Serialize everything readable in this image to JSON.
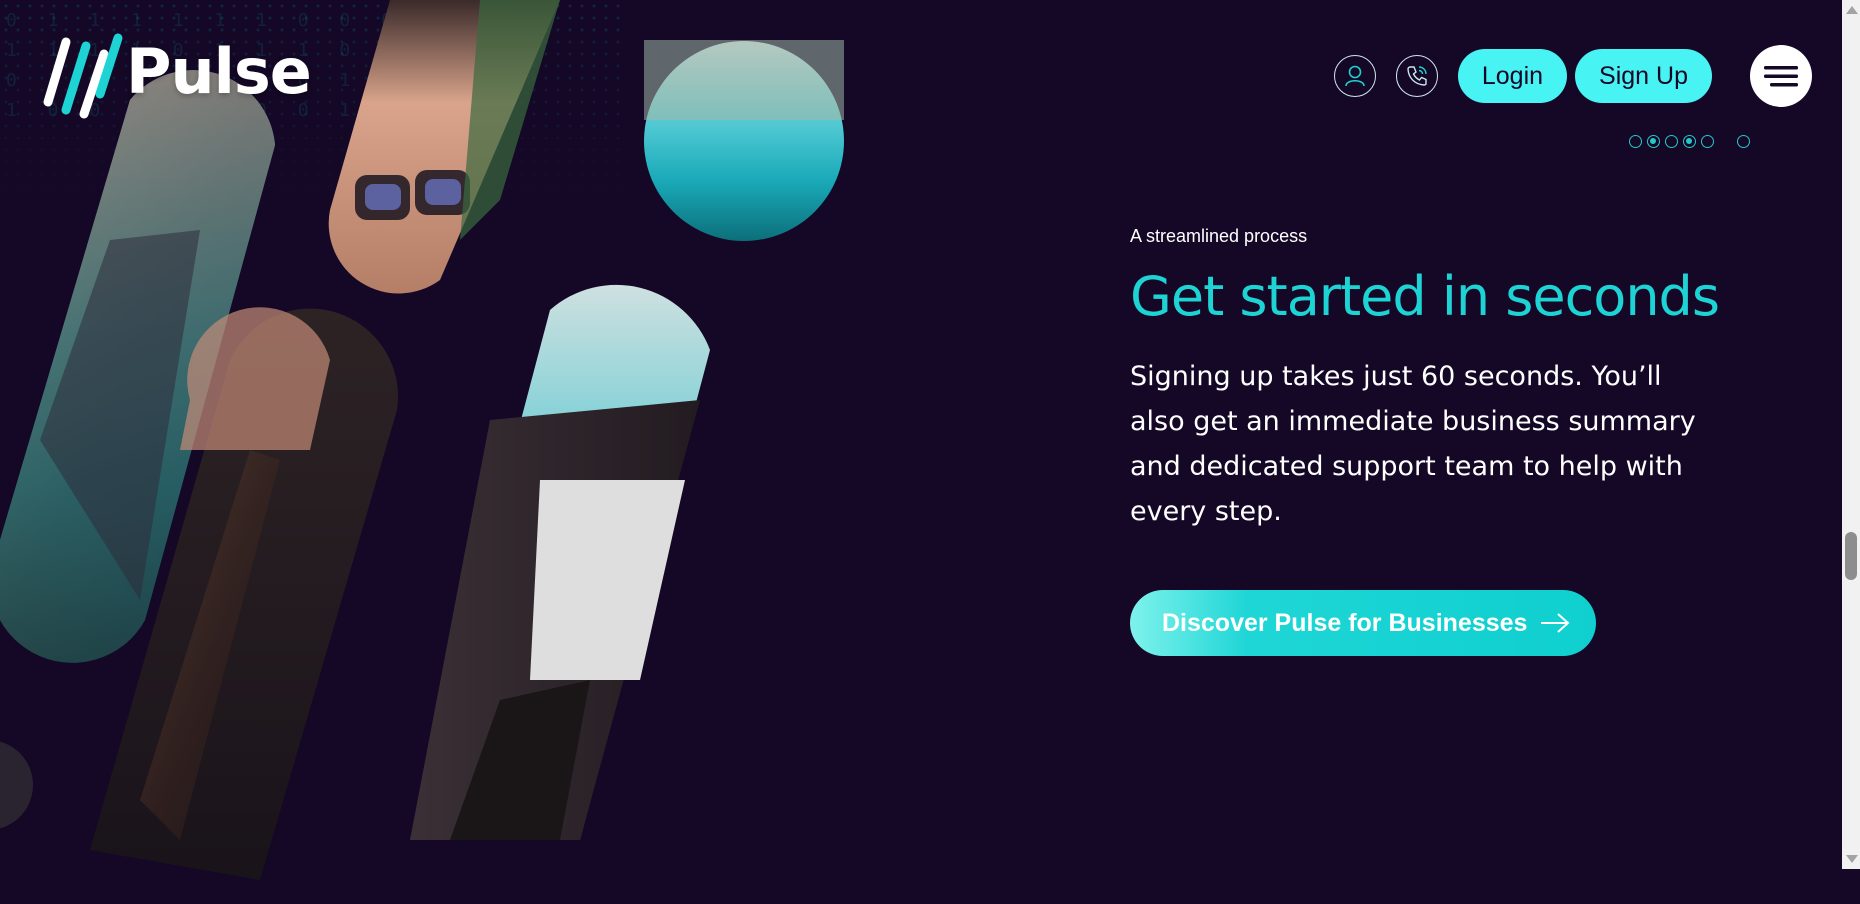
{
  "header": {
    "logo_text": "Pulse",
    "account_icon": "user-icon",
    "phone_icon": "phone-icon",
    "login_label": "Login",
    "signup_label": "Sign Up",
    "menu_icon": "hamburger-menu-icon"
  },
  "pagination": {
    "count": 6,
    "active_indices": [
      1,
      3
    ]
  },
  "hero": {
    "eyebrow": "A streamlined process",
    "headline": "Get started in seconds",
    "body": "Signing up takes just 60 seconds. You’ll also get an immediate business summary and dedicated support team to help with every step.",
    "cta_label": "Discover Pulse for Businesses",
    "cta_icon": "arrow-right-icon"
  },
  "colors": {
    "background": "#140826",
    "accent": "#1dd3d3",
    "button": "#47f3f3"
  },
  "background_digits": "0 1 1 1 1 1 1 0 0 0 0 0 0\n1 1 1 1 0 1 1 1 0 0 0 1\n0 1 0 1 1 0 1 0 1 0 1 0\n1 0 0 0 1 0 0 0 1 0"
}
